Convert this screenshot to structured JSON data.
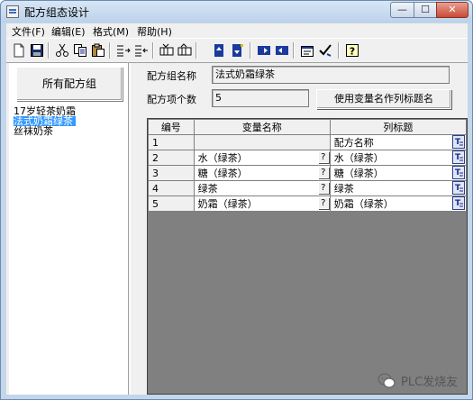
{
  "window": {
    "title": "配方组态设计",
    "minimize": "—",
    "maximize": "☐",
    "close": "✕"
  },
  "menu": [
    {
      "label": "文件(F)"
    },
    {
      "label": "编辑(E)"
    },
    {
      "label": "格式(M)"
    },
    {
      "label": "帮助(H)"
    }
  ],
  "toolbar": [
    "new",
    "save",
    "cut",
    "copy",
    "paste",
    "insert-row",
    "delete-row",
    "insert-col",
    "delete-col",
    "move-up",
    "move-down",
    "move-left",
    "move-right",
    "properties",
    "check",
    "help"
  ],
  "left": {
    "group_button": "所有配方组",
    "groups": [
      "17岁轻茶奶霜",
      "法式奶霜绿茶",
      "丝袜奶茶"
    ],
    "selected_index": 1
  },
  "form": {
    "group_name_label": "配方组名称",
    "group_name_value": "法式奶霜绿茶",
    "item_count_label": "配方项个数",
    "item_count_value": "5",
    "use_var_button": "使用变量名作列标题名"
  },
  "grid": {
    "headers": [
      "编号",
      "变量名称",
      "列标题"
    ],
    "rows": [
      {
        "no": "1",
        "var": "",
        "title": "配方名称"
      },
      {
        "no": "2",
        "var": "水（绿茶）",
        "title": "水（绿茶）"
      },
      {
        "no": "3",
        "var": "糖（绿茶）",
        "title": "糖（绿茶）"
      },
      {
        "no": "4",
        "var": "绿茶",
        "title": "绿茶"
      },
      {
        "no": "5",
        "var": "奶霜（绿茶）",
        "title": "奶霜（绿茶）"
      }
    ],
    "pick_button": "?"
  },
  "watermark": "PLC发烧友"
}
